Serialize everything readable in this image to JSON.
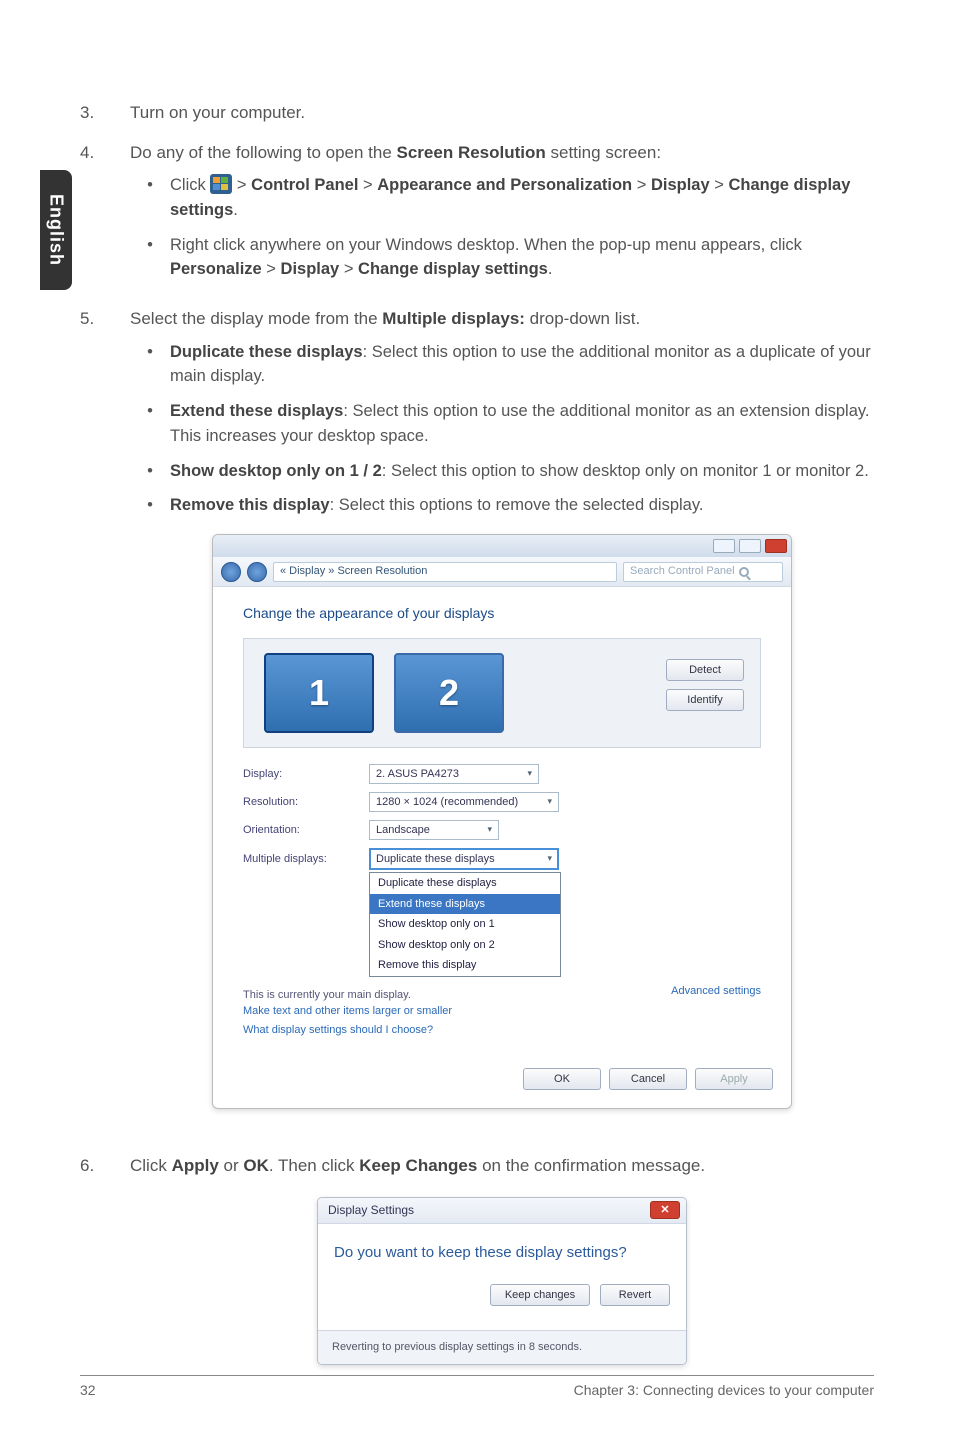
{
  "lang_tab": "English",
  "steps": {
    "s3": {
      "num": "3.",
      "text": "Turn on your computer."
    },
    "s4": {
      "num": "4.",
      "intro_a": "Do any of the following to open the ",
      "intro_bold": "Screen Resolution",
      "intro_b": " setting screen:",
      "bullets": {
        "b1": {
          "click": "Click ",
          "sep1": " > ",
          "cp": "Control Panel",
          "ap": "Appearance and Personalization",
          "disp": "Display",
          "cds": "Change display settings",
          "dot": "."
        },
        "b2": {
          "a": "Right click anywhere on your Windows desktop. When the pop-up menu appears, click ",
          "p": "Personalize",
          "sep": " > ",
          "d": "Display",
          "cds": "Change display settings",
          "dot": "."
        }
      }
    },
    "s5": {
      "num": "5.",
      "intro_a": "Select the display mode from the ",
      "intro_bold": "Multiple displays:",
      "intro_b": " drop-down list.",
      "bullets": {
        "b1": {
          "title": "Duplicate these displays",
          "rest": ": Select this option to use the additional monitor as a duplicate of your main display."
        },
        "b2": {
          "title": "Extend these displays",
          "rest": ": Select this option to use the additional monitor as an extension display. This increases your desktop space."
        },
        "b3": {
          "title": "Show desktop only on 1 / 2",
          "rest": ": Select this option to show desktop only on monitor 1 or monitor 2."
        },
        "b4": {
          "title": "Remove this display",
          "rest": ": Select this options to remove the selected display."
        }
      }
    },
    "s6": {
      "num": "6.",
      "a": "Click ",
      "apply": "Apply",
      "or": " or ",
      "ok": "OK",
      "b": ". Then click ",
      "kc": "Keep Changes",
      "c": " on the confirmation message."
    }
  },
  "sr_dialog": {
    "addr": "« Display » Screen Resolution",
    "search_ph": "Search Control Panel",
    "heading": "Change the appearance of your displays",
    "mon1": "1",
    "mon2": "2",
    "btn_detect": "Detect",
    "btn_identify": "Identify",
    "fields": {
      "display": {
        "lbl": "Display:",
        "val": "2. ASUS PA4273"
      },
      "resolution": {
        "lbl": "Resolution:",
        "val": "1280 × 1024 (recommended)"
      },
      "orientation": {
        "lbl": "Orientation:",
        "val": "Landscape"
      },
      "multi": {
        "lbl": "Multiple displays:",
        "val": "Duplicate these displays"
      }
    },
    "dd_options": {
      "o1": "Duplicate these displays",
      "o2": "Extend these displays",
      "o3": "Show desktop only on 1",
      "o4": "Show desktop only on 2",
      "o5": "Remove this display"
    },
    "note1": "This is currently your main display.",
    "link1": "Make text and other items larger or smaller",
    "link2": "What display settings should I choose?",
    "adv": "Advanced settings",
    "btn_ok": "OK",
    "btn_cancel": "Cancel",
    "btn_apply": "Apply"
  },
  "kc_dialog": {
    "title": "Display Settings",
    "close": "✕",
    "question": "Do you want to keep these display settings?",
    "btn_keep": "Keep changes",
    "btn_revert": "Revert",
    "footer": "Reverting to previous display settings in 8 seconds."
  },
  "footer": {
    "page": "32",
    "chapter": "Chapter 3: Connecting devices to your computer"
  }
}
